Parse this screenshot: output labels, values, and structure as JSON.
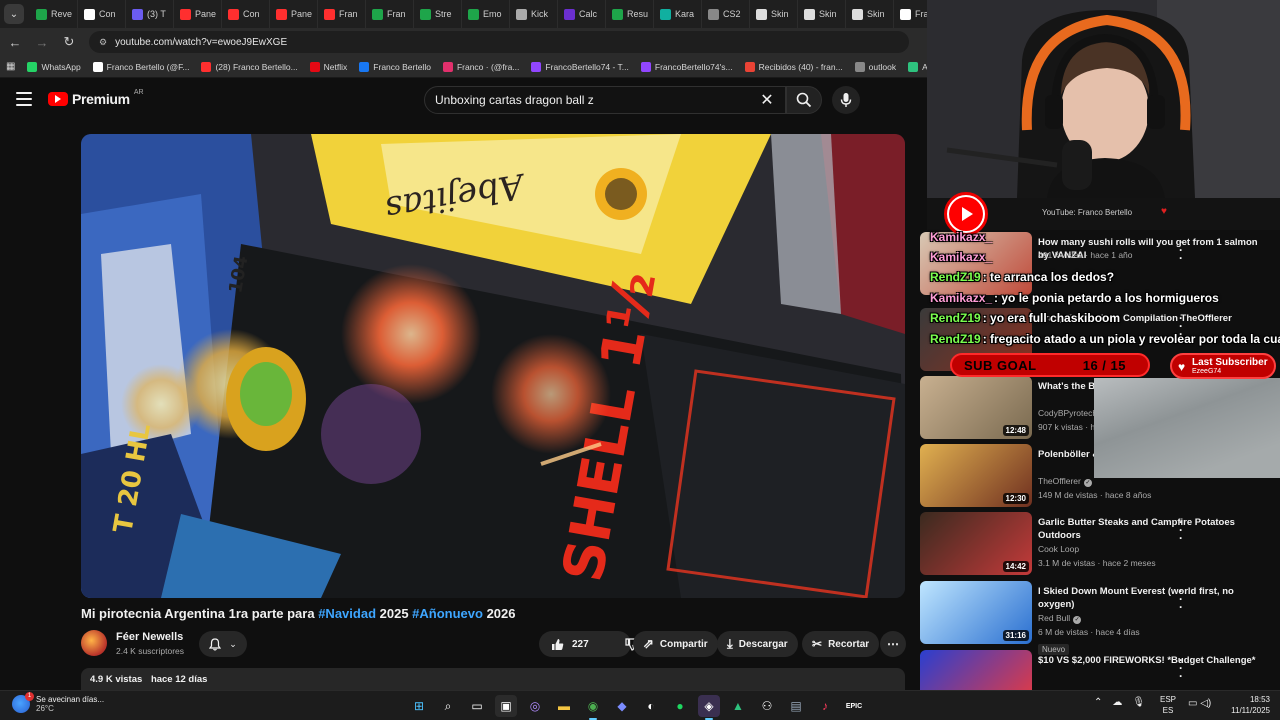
{
  "browser": {
    "tabs": [
      "Reve",
      "Con",
      "(3) T",
      "Pane",
      "Con",
      "Pane",
      "Fran",
      "Fran",
      "Stre",
      "Emo",
      "Kick",
      "Calc",
      "Resu",
      "Kara",
      "CS2",
      "Skin",
      "Skin",
      "Skin",
      "Fra"
    ],
    "url": "youtube.com/watch?v=ewoeJ9EwXGE",
    "bookmarks": [
      "WhatsApp",
      "Franco Bertello (@F...",
      "(28) Franco Bertello...",
      "Netflix",
      "Franco Bertello",
      "Franco · (@fra...",
      "FrancoBertello74 - T...",
      "FrancoBertello74's...",
      "Recibidos (40) - fran...",
      "outlook",
      "Aler"
    ]
  },
  "header": {
    "logo_text": "Premium",
    "country": "AR",
    "search_value": "Unboxing cartas dragon ball z"
  },
  "video": {
    "title_part1": "Mi pirotecnia Argentina 1ra parte para ",
    "title_tag1": "#Navidad",
    "title_part2": " 2025 ",
    "title_tag2": "#Añonuevo",
    "title_part3": " 2026",
    "thumb_text_shell": "SHELL 1½",
    "thumb_text_box": "Abejitas",
    "thumb_text_t": "T 20 HL",
    "thumb_text_104": "104"
  },
  "channel": {
    "name": "Féer Newells",
    "subs": "2.4 K suscriptores"
  },
  "actions": {
    "likes": "227",
    "share": "Compartir",
    "download": "Descargar",
    "clip": "Recortar"
  },
  "description": {
    "views": "4.9 K vistas",
    "date": "hace 12 días"
  },
  "related": [
    {
      "title": "How many sushi rolls will you get from 1 salmon by VANZAI",
      "channel": "",
      "meta": "491 k vistas · hace 1 año",
      "duration": ""
    },
    {
      "title": "Crazy firecrackers Compilation TheOfflerer",
      "channel": "",
      "meta": "",
      "duration": ""
    },
    {
      "title": "What's the Be... Rocket?",
      "channel": "CodyBPyrotech...",
      "meta": "907 k vistas · ha...",
      "duration": "12:48"
    },
    {
      "title": "Polenböller &... Tschechenbö...",
      "channel": "TheOfflerer",
      "meta": "149 M de vistas · hace 8 años",
      "duration": "12:30"
    },
    {
      "title": "Garlic Butter Steaks and Campfire Potatoes Outdoors",
      "channel": "Cook Loop",
      "meta": "3.1 M de vistas · hace 2 meses",
      "duration": "14:42"
    },
    {
      "title": "I Skied Down Mount Everest (world first, no oxygen)",
      "channel": "Red Bull",
      "meta": "6 M de vistas · hace 4 días",
      "badge": "Nuevo",
      "duration": "31:16"
    },
    {
      "title": "$10 VS $2,000 FIREWORKS! *Budget Challenge*",
      "channel": "",
      "meta": "",
      "duration": ""
    }
  ],
  "stream": {
    "banner_text": "YouTube: Franco Bertello",
    "chat": [
      {
        "user": "Kamikazx_",
        "msg": ""
      },
      {
        "user": "Kamikazx_",
        "msg": ""
      },
      {
        "user": "RendZ19",
        "msg": ": te arranca los dedos?"
      },
      {
        "user": "Kamikazx_",
        "msg": ": yo le ponia petardo a los hormigueros"
      },
      {
        "user": "RendZ19",
        "msg": ": yo era full chaskiboom"
      },
      {
        "user": "RendZ19",
        "msg": ": fregacito atado a un piola y revolear por toda la cuadra"
      }
    ],
    "sub_goal_label": "SUB GOAL",
    "sub_goal_value": "16 / 15",
    "last_sub_label": "Last Subscriber",
    "last_sub_name": "EzeeG74"
  },
  "taskbar": {
    "weather_text": "Se avecinan días...",
    "temp": "26°C",
    "weather_badge": "1",
    "lang1": "ESP",
    "lang2": "ES",
    "time": "18:53",
    "date": "11/11/2025"
  },
  "colors": {
    "accent_red": "#ff0000",
    "link_blue": "#3ea6ff",
    "chat_green": "#7cff4f",
    "chat_pink": "#ff9dd6"
  }
}
